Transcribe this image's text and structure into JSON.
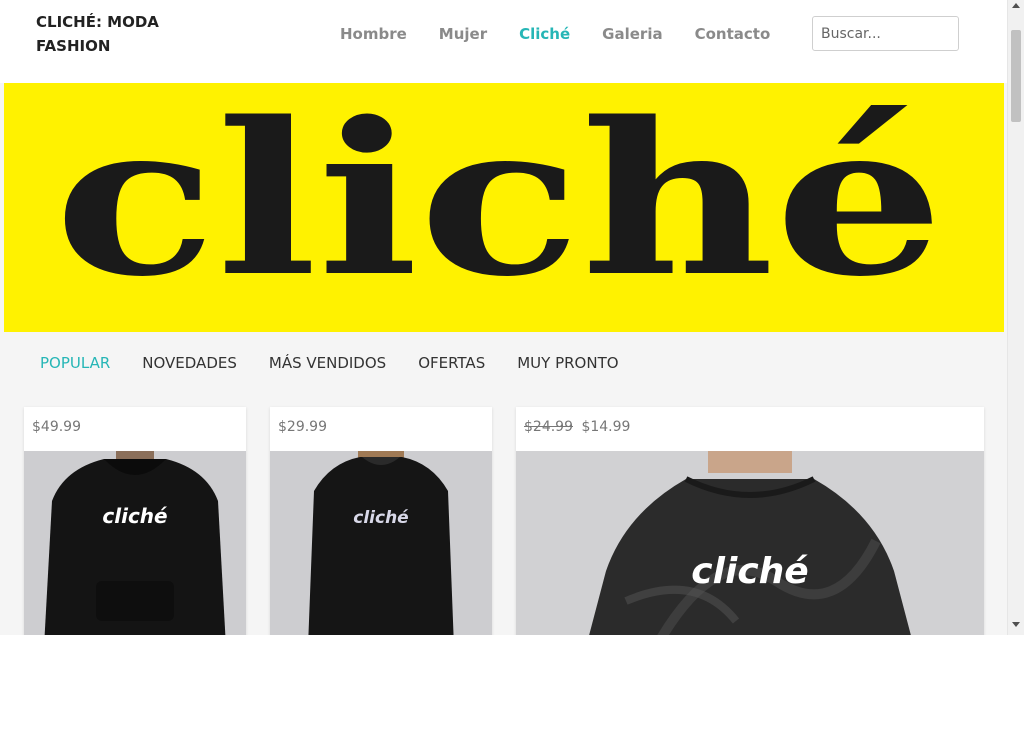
{
  "brand": {
    "line1": "CLICHÉ: MODA",
    "line2": "FASHION"
  },
  "nav": [
    {
      "label": "Hombre",
      "active": false
    },
    {
      "label": "Mujer",
      "active": false
    },
    {
      "label": "Cliché",
      "active": true
    },
    {
      "label": "Galeria",
      "active": false
    },
    {
      "label": "Contacto",
      "active": false
    }
  ],
  "search": {
    "placeholder": "Buscar..."
  },
  "banner": {
    "logo_text": "cliché",
    "background": "#fff200"
  },
  "tabs": [
    {
      "label": "POPULAR",
      "active": true
    },
    {
      "label": "NOVEDADES",
      "active": false
    },
    {
      "label": "MÁS VENDIDOS",
      "active": false
    },
    {
      "label": "OFERTAS",
      "active": false
    },
    {
      "label": "MUY PRONTO",
      "active": false
    }
  ],
  "products": [
    {
      "price": "$49.99",
      "old_price": "",
      "item": "black hoodie",
      "print_text": "cliché"
    },
    {
      "price": "$29.99",
      "old_price": "",
      "item": "black sweatshirt",
      "print_text": "cliché"
    },
    {
      "price": "$14.99",
      "old_price": "$24.99",
      "item": "tie-dye t-shirt",
      "print_text": "cliché"
    }
  ],
  "colors": {
    "accent": "#26b6b6",
    "nav_text": "#8a8a8a",
    "banner_yellow": "#fff200"
  }
}
